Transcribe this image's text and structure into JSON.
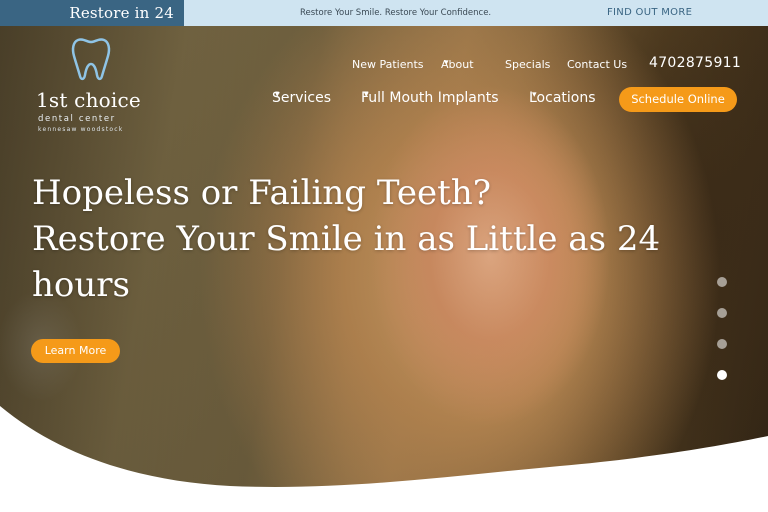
{
  "promo": {
    "badge": "Restore in 24",
    "tagline": "Restore Your Smile. Restore Your Confidence.",
    "cta": "FIND OUT MORE"
  },
  "logo": {
    "name": "1st choice",
    "subtitle": "dental center",
    "locations": "kennesaw  woodstock"
  },
  "nav": {
    "top": [
      "New Patients",
      "About",
      "Specials",
      "Contact Us"
    ],
    "phone": "4702875911",
    "main": [
      "Services",
      "Full Mouth Implants",
      "Locations"
    ],
    "schedule": "Schedule Online"
  },
  "hero": {
    "headline_line1": "Hopeless or Failing Teeth?",
    "headline_line2": "Restore Your Smile in as Little as 24 hours",
    "button": "Learn More",
    "slides_total": 4,
    "active_slide": 4
  },
  "colors": {
    "accent": "#f59a19",
    "badge_bg": "#3a6583",
    "topbar_bg": "#cfe4f1",
    "tooth_icon": "#8fc4e6"
  },
  "icons": {
    "logo": "tooth-icon",
    "dropdown": "chevron-down-icon"
  }
}
